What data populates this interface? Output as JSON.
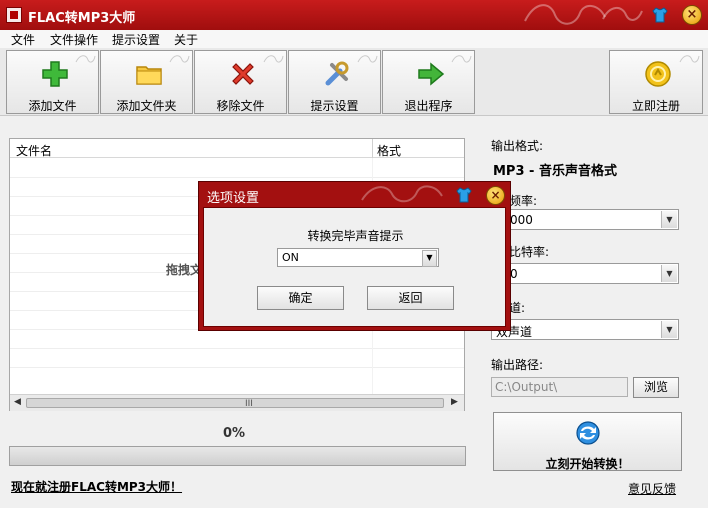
{
  "window": {
    "title": "FLAC转MP3大师"
  },
  "menu": [
    "文件",
    "文件操作",
    "提示设置",
    "关于"
  ],
  "toolbar": [
    {
      "label": "添加文件",
      "icon": "plus-icon"
    },
    {
      "label": "添加文件夹",
      "icon": "folder-icon"
    },
    {
      "label": "移除文件",
      "icon": "x-icon"
    },
    {
      "label": "提示设置",
      "icon": "tools-icon"
    },
    {
      "label": "退出程序",
      "icon": "arrow-right-icon"
    }
  ],
  "register_button": {
    "label": "立即注册",
    "icon": "coin-icon"
  },
  "file_list": {
    "columns": [
      "文件名",
      "格式"
    ],
    "drop_hint": "拖拽文",
    "scroll_grip": "III"
  },
  "progress": {
    "text": "0%",
    "value": 0
  },
  "register_link": "现在就注册FLAC转MP3大师！",
  "feedback_link": "意见反馈",
  "output": {
    "format_label": "输出格式:",
    "format_value": "MP3 - 音乐声音格式",
    "samplerate_label": "频率:",
    "samplerate_value": "000",
    "bitrate_label": "比特率:",
    "bitrate_value": "0",
    "channel_label": "道:",
    "channel_value": "双声道",
    "path_label": "输出路径:",
    "path_value": "C:\\Output\\",
    "browse_label": "浏览",
    "start_label": "立刻开始转换！"
  },
  "dialog": {
    "title": "选项设置",
    "label": "转换完毕声音提示",
    "select_value": "ON",
    "ok_label": "确定",
    "back_label": "返回"
  },
  "colors": {
    "accent": "#a31010",
    "accent_dark": "#5a0000",
    "close_gold": "#e79b00"
  }
}
